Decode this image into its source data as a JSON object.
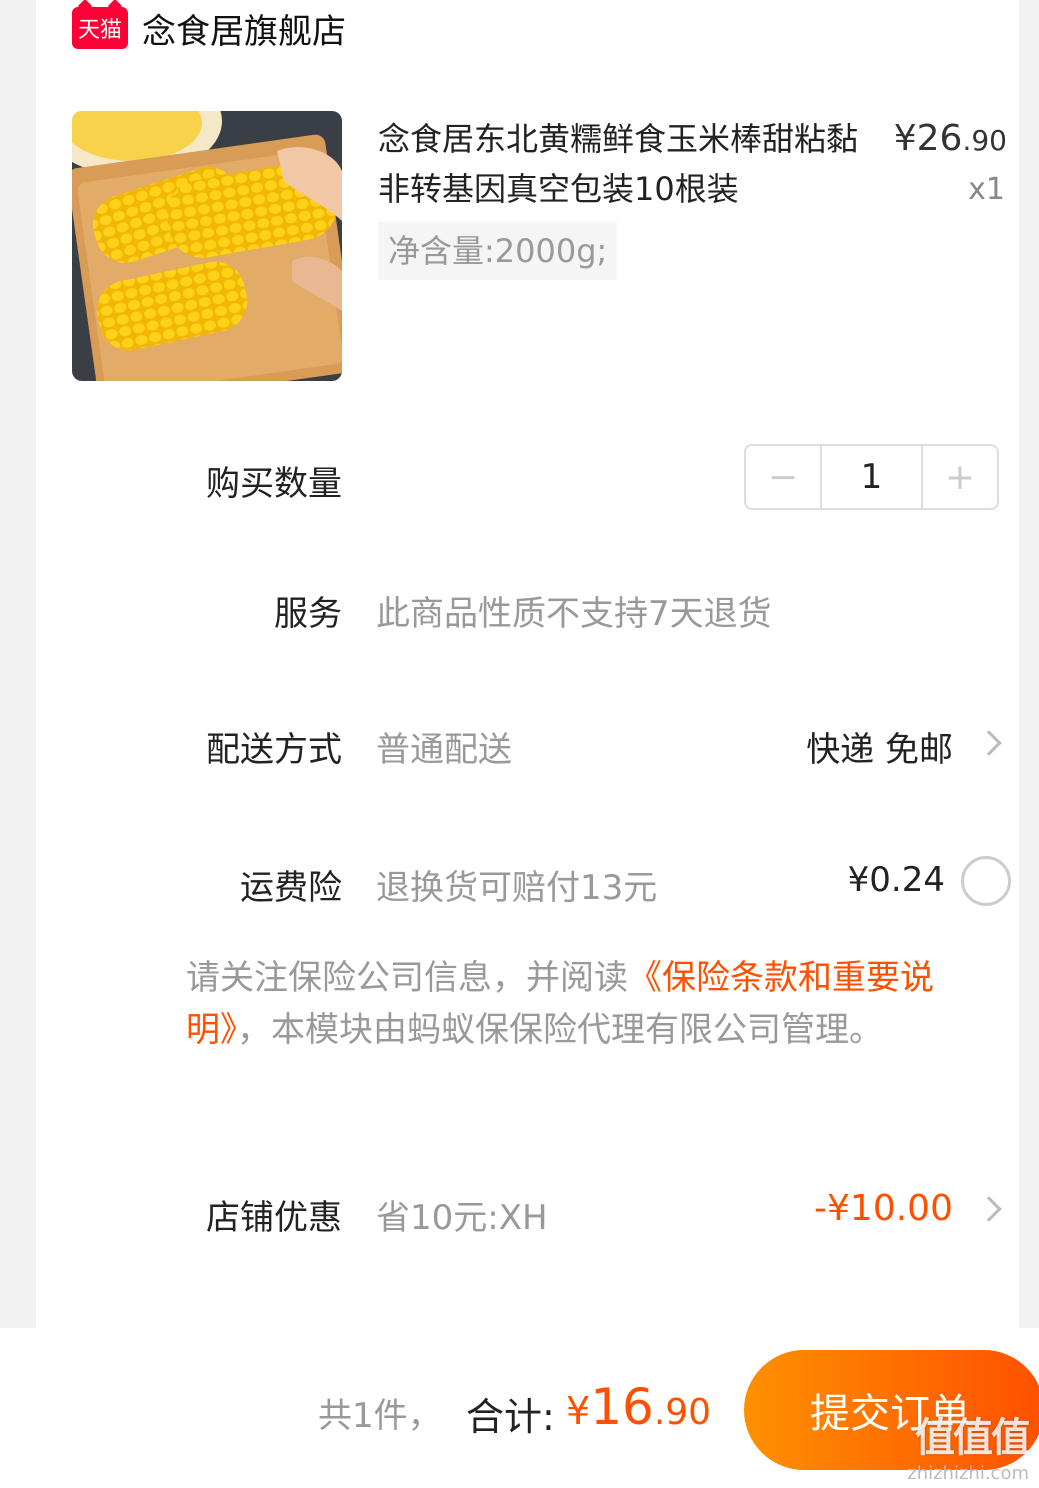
{
  "store": {
    "badge": "天猫",
    "name": "念食居旗舰店"
  },
  "product": {
    "title": "念食居东北黄糯鲜食玉米棒甜粘黏非转基因真空包装10根装",
    "price_int": "26",
    "price_dec": ".90",
    "price_symbol": "¥",
    "quantity_label": "x1",
    "spec": "净含量:2000g;"
  },
  "quantity": {
    "label": "购买数量",
    "minus": "−",
    "value": "1",
    "plus": "+"
  },
  "service": {
    "label": "服务",
    "value": "此商品性质不支持7天退货"
  },
  "delivery": {
    "label": "配送方式",
    "value": "普通配送",
    "right": "快递 免邮"
  },
  "insurance": {
    "label": "运费险",
    "value": "退换货可赔付13元",
    "price": "¥0.24"
  },
  "notice": {
    "prefix": "请关注保险公司信息，并阅读",
    "link": "《保险条款和重要说明》",
    "suffix": "，本模块由蚂蚁保保险代理有限公司管理。"
  },
  "store_discount": {
    "label": "店铺优惠",
    "value": "省10元:XH",
    "amount": "-¥10.00"
  },
  "footer": {
    "count": "共1件，",
    "total_label": "合计:",
    "total_symbol": "¥",
    "total_int": "16",
    "total_dec": ".90",
    "submit": "提交订单"
  },
  "watermark": {
    "logo": "值值值",
    "url": "zhizhizhi.com"
  },
  "colors": {
    "accent": "#ff5000",
    "tmall": "#ff0036",
    "gradient_start": "#ff9000"
  }
}
